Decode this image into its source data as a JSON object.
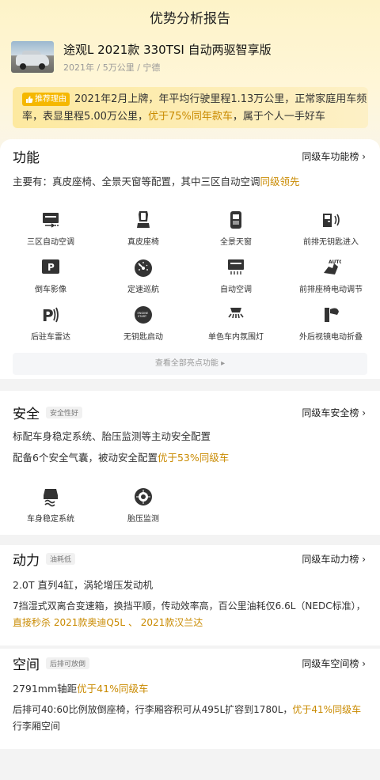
{
  "header": {
    "title": "优势分析报告"
  },
  "car": {
    "name": "途观L 2021款 330TSI 自动两驱智享版",
    "meta": "2021年 / 5万公里 / 宁德"
  },
  "recommend": {
    "badge": "推荐理由",
    "text_plain": "2021年2月上牌，年平均行驶里程1.13万公里，正常家庭用车频率，表显里程5.00万公里，",
    "text_highlight": "优于75%同年款车",
    "text_tail": "，属于个人一手好车"
  },
  "function": {
    "title": "功能",
    "rank_link": "同级车功能榜 ›",
    "summary_plain": "主要有：真皮座椅、全景天窗等配置，其中三区自动空调",
    "summary_highlight": "同级领先",
    "features": [
      {
        "label": "三区自动空调",
        "icon": "climate-zone-icon"
      },
      {
        "label": "真皮座椅",
        "icon": "leather-seat-icon"
      },
      {
        "label": "全景天窗",
        "icon": "sunroof-icon"
      },
      {
        "label": "前排无钥匙进入",
        "icon": "keyless-entry-icon"
      },
      {
        "label": "倒车影像",
        "icon": "reverse-camera-icon"
      },
      {
        "label": "定速巡航",
        "icon": "cruise-control-icon"
      },
      {
        "label": "自动空调",
        "icon": "auto-ac-icon"
      },
      {
        "label": "前排座椅电动调节",
        "icon": "power-seat-icon"
      },
      {
        "label": "后驻车雷达",
        "icon": "parking-radar-icon"
      },
      {
        "label": "无钥匙启动",
        "icon": "start-button-icon"
      },
      {
        "label": "单色车内氛围灯",
        "icon": "ambient-light-icon"
      },
      {
        "label": "外后视镜电动折叠",
        "icon": "mirror-fold-icon"
      }
    ],
    "more_button": "查看全部亮点功能 ▸"
  },
  "safety": {
    "title": "安全",
    "tag": "安全性好",
    "rank_link": "同级车安全榜 ›",
    "line1": "标配车身稳定系统、胎压监测等主动安全配置",
    "line2_plain": "配备6个安全气囊，被动安全配置",
    "line2_highlight": "优于53%同级车",
    "features": [
      {
        "label": "车身稳定系统",
        "icon": "stability-control-icon"
      },
      {
        "label": "胎压监测",
        "icon": "tire-pressure-icon"
      }
    ]
  },
  "power": {
    "title": "动力",
    "tag": "油耗低",
    "rank_link": "同级车动力榜 ›",
    "line1": "2.0T 直列4缸，涡轮增压发动机",
    "line2_plain": "7挡湿式双离合变速箱，换挡平顺，传动效率高，百公里油耗仅6.6L（NEDC标准），",
    "line2_highlight": "直接秒杀 2021款奥迪Q5L",
    "line2_sep": " 、 ",
    "line2_highlight2": "2021款汉兰达"
  },
  "space": {
    "title": "空间",
    "tag": "后排可放倒",
    "rank_link": "同级车空间榜 ›",
    "line1_plain": "2791mm轴距",
    "line1_highlight": "优于41%同级车",
    "line2_plain": "后排可40:60比例放倒座椅，行李厢容积可从495L扩容到1780L，",
    "line2_highlight": "优于41%同级车",
    "line2_tail": "行李厢空间"
  },
  "colors": {
    "accent": "#c98a00",
    "badge": "#f5b800",
    "header_bg": "#fdf3c8"
  }
}
